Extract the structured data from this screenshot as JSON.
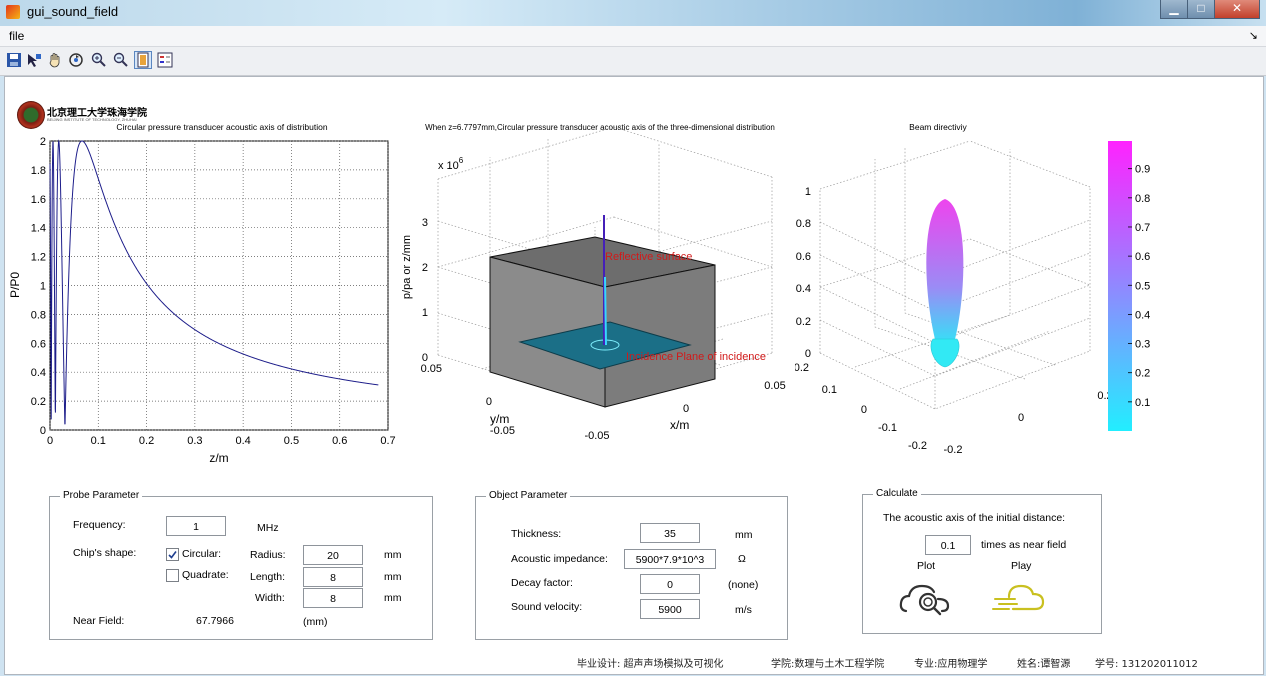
{
  "window": {
    "title": "gui_sound_field",
    "min_glyph": "▁",
    "max_glyph": "□",
    "close_glyph": "✕"
  },
  "menu": {
    "file": "file",
    "more_arrow": "↘"
  },
  "toolbar": {
    "icons": [
      "save-icon",
      "insert-data-cursor-icon",
      "pan-hand-icon",
      "rotate-3d-icon",
      "zoom-in-icon",
      "zoom-out-icon",
      "colorbar-icon",
      "legend-icon"
    ]
  },
  "logo": {
    "chinese": "北京理工大学珠海学院",
    "english": "BEIJING INSTITUTE OF TECHNOLOGY, ZHUHAI"
  },
  "plot1": {
    "title": "Circular pressure transducer acoustic axis of distribution",
    "xlabel": "z/m",
    "ylabel": "P/P0",
    "x_ticks": [
      "0",
      "0.1",
      "0.2",
      "0.3",
      "0.4",
      "0.5",
      "0.6",
      "0.7"
    ],
    "y_ticks": [
      "0",
      "0.2",
      "0.4",
      "0.6",
      "0.8",
      "1",
      "1.2",
      "1.4",
      "1.6",
      "1.8",
      "2"
    ]
  },
  "plot2": {
    "title": "When z=6.7797mm,Circular pressure transducer acoustic axis of the three-dimensional distribution",
    "exponent_base": "x 10",
    "exponent_power": "6",
    "zlabel": "p/pa or z/mm",
    "ylabel": "y/m",
    "xlabel": "x/m",
    "z_ticks": [
      "0",
      "1",
      "2",
      "3"
    ],
    "y_ticks": [
      "0.05",
      "0",
      "-0.05"
    ],
    "x_ticks": [
      "-0.05",
      "0",
      "0.05"
    ],
    "annotation_reflective": "Reflective surface",
    "annotation_incidence": "Incidence Plane of incidence",
    "annotation_color": "#d11a1a"
  },
  "plot3": {
    "title": "Beam directiviy",
    "z_ticks": [
      "0",
      "0.2",
      "0.4",
      "0.6",
      "0.8",
      "1"
    ],
    "y_ticks": [
      "0.2",
      "0.1",
      "0",
      "-0.1",
      "-0.2"
    ],
    "x_ticks": [
      "-0.2",
      "0",
      "0.2"
    ],
    "colorbar_ticks": [
      "0.9",
      "0.8",
      "0.7",
      "0.6",
      "0.5",
      "0.4",
      "0.3",
      "0.2",
      "0.1"
    ],
    "colormap_top": "#ff22ff",
    "colormap_bottom": "#22eeff"
  },
  "probe": {
    "panel_title": "Probe Parameter",
    "frequency_label": "Frequency:",
    "frequency_value": "1",
    "frequency_unit": "MHz",
    "shape_label": "Chip's shape:",
    "circular_label": "Circular:",
    "circular_checked": true,
    "quadrate_label": "Quadrate:",
    "quadrate_checked": false,
    "radius_label": "Radius:",
    "radius_value": "20",
    "radius_unit": "mm",
    "length_label": "Length:",
    "length_value": "8",
    "length_unit": "mm",
    "width_label": "Width:",
    "width_value": "8",
    "width_unit": "mm",
    "near_field_label": "Near Field:",
    "near_field_value": "67.7966",
    "near_field_unit": "(mm)"
  },
  "object": {
    "panel_title": "Object Parameter",
    "thickness_label": "Thickness:",
    "thickness_value": "35",
    "thickness_unit": "mm",
    "impedance_label": "Acoustic impedance:",
    "impedance_value": "5900*7.9*10^3",
    "impedance_unit": "Ω",
    "decay_label": "Decay factor:",
    "decay_value": "0",
    "decay_unit": "(none)",
    "velocity_label": "Sound velocity:",
    "velocity_value": "5900",
    "velocity_unit": "m/s"
  },
  "calculate": {
    "panel_title": "Calculate",
    "initial_distance_label": "The acoustic axis of the initial distance:",
    "initial_distance_value": "0.1",
    "initial_distance_unit": "times as near field",
    "plot_label": "Plot",
    "play_label": "Play"
  },
  "footer": {
    "design": "毕业设计: 超声声场模拟及可视化",
    "college": "学院:数理与土木工程学院",
    "major": "专业:应用物理学",
    "name": "姓名:谭智源",
    "student_id": "学号: 131202011012"
  }
}
